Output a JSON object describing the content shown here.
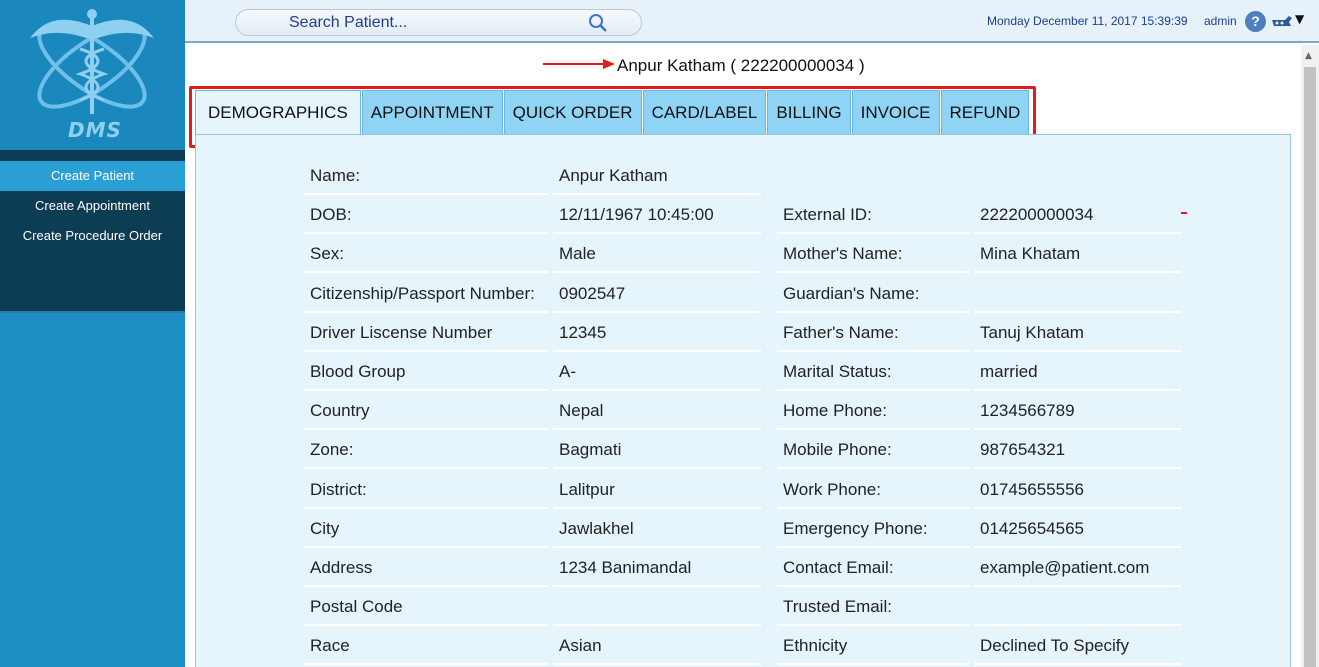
{
  "logo": {
    "text": "DMS"
  },
  "sidebar": {
    "items": [
      {
        "label": "Create Patient",
        "active": true
      },
      {
        "label": "Create Appointment",
        "active": false
      },
      {
        "label": "Create Procedure Order",
        "active": false
      }
    ]
  },
  "topbar": {
    "search_placeholder": "Search Patient...",
    "datetime": "Monday December 11, 2017 15:39:39",
    "user": "admin",
    "help_icon": "?"
  },
  "patient": {
    "title": "Anpur Katham ( 222200000034 )"
  },
  "tabs": [
    {
      "label": "DEMOGRAPHICS",
      "active": true
    },
    {
      "label": "APPOINTMENT",
      "active": false
    },
    {
      "label": "QUICK ORDER",
      "active": false
    },
    {
      "label": "CARD/LABEL",
      "active": false
    },
    {
      "label": "BILLING",
      "active": false
    },
    {
      "label": "INVOICE",
      "active": false
    },
    {
      "label": "REFUND",
      "active": false
    }
  ],
  "left_fields": [
    {
      "label": "Name:",
      "value": "Anpur  Katham"
    },
    {
      "label": "DOB:",
      "value": "12/11/1967 10:45:00"
    },
    {
      "label": "Sex:",
      "value": "Male"
    },
    {
      "label": "Citizenship/Passport Number:",
      "value": "0902547"
    },
    {
      "label": "Driver Liscense Number",
      "value": "12345"
    },
    {
      "label": "Blood Group",
      "value": "A-"
    },
    {
      "label": "Country",
      "value": "Nepal"
    },
    {
      "label": "Zone:",
      "value": "Bagmati"
    },
    {
      "label": "District:",
      "value": "Lalitpur"
    },
    {
      "label": "City",
      "value": "Jawlakhel"
    },
    {
      "label": "Address",
      "value": "1234 Banimandal"
    },
    {
      "label": "Postal Code",
      "value": ""
    },
    {
      "label": "Race",
      "value": "Asian"
    }
  ],
  "right_fields": [
    {
      "label": "External ID:",
      "value": "222200000034"
    },
    {
      "label": "Mother's Name:",
      "value": "Mina Khatam"
    },
    {
      "label": "Guardian's Name:",
      "value": ""
    },
    {
      "label": "Father's Name:",
      "value": "Tanuj Khatam"
    },
    {
      "label": "Marital Status:",
      "value": "married"
    },
    {
      "label": "Home Phone:",
      "value": "1234566789"
    },
    {
      "label": "Mobile Phone:",
      "value": "987654321"
    },
    {
      "label": "Work Phone:",
      "value": "01745655556"
    },
    {
      "label": "Emergency Phone:",
      "value": "01425654565"
    },
    {
      "label": "Contact Email:",
      "value": "example@patient.com"
    },
    {
      "label": "Trusted Email:",
      "value": ""
    },
    {
      "label": "Ethnicity",
      "value": "Declined To Specify"
    }
  ],
  "colors": {
    "sidebar": "#1d8fc4",
    "menu": "#0d3c55",
    "tab": "#8fd3f5",
    "panel": "#e6f4fb",
    "annotation": "#e21b1b"
  }
}
